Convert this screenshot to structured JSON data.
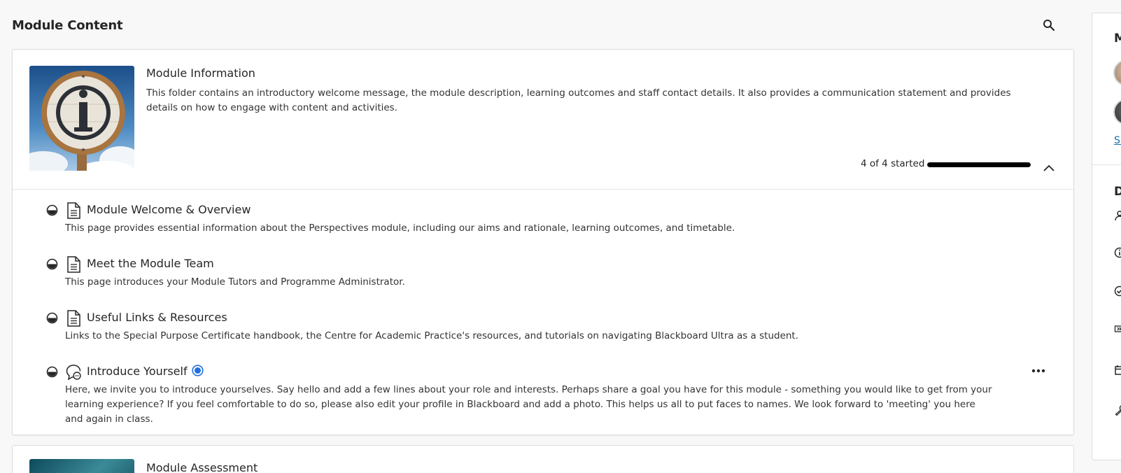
{
  "page": {
    "title": "Module Content"
  },
  "folder": {
    "title": "Module Information",
    "description": "This folder contains an introductory welcome message, the module description, learning outcomes and staff contact details. It also provides a communication statement and provides details on how to engage with content and activities.",
    "progress_text": "4 of 4 started",
    "progress_fraction": 1.0
  },
  "items": [
    {
      "title": "Module Welcome & Overview",
      "description": "This page provides essential information about the Perspectives module, including our aims and rationale, learning outcomes, and timetable.",
      "type": "document-icon"
    },
    {
      "title": "Meet the Module Team",
      "description": "This page introduces your Module Tutors and Programme Administrator.",
      "type": "document-icon"
    },
    {
      "title": "Useful Links & Resources",
      "description": "Links to the Special Purpose Certificate handbook, the Centre for Academic Practice's resources, and tutorials on navigating Blackboard Ultra as a student.",
      "type": "document-icon"
    },
    {
      "title": "Introduce Yourself",
      "description": "Here, we invite you to introduce yourselves. Say hello and add a few lines about your role and interests. Perhaps share a goal you have for this module - something you would like to get from your learning experience? If you feel comfortable to do so, please also edit your profile in Blackboard and add a photo. This helps us all to put faces to names. We look forward to 'meeting' you here and again in class.",
      "type": "discussion-icon"
    }
  ],
  "next_folder": {
    "title": "Module Assessment"
  },
  "side_panel": {
    "title": "M",
    "link": "Sh",
    "title2": "D"
  },
  "colors": {
    "accent": "#1a6fa8",
    "new_badge": "#1f6fe0",
    "progress": "#000000",
    "background": "#f8f8f8"
  }
}
